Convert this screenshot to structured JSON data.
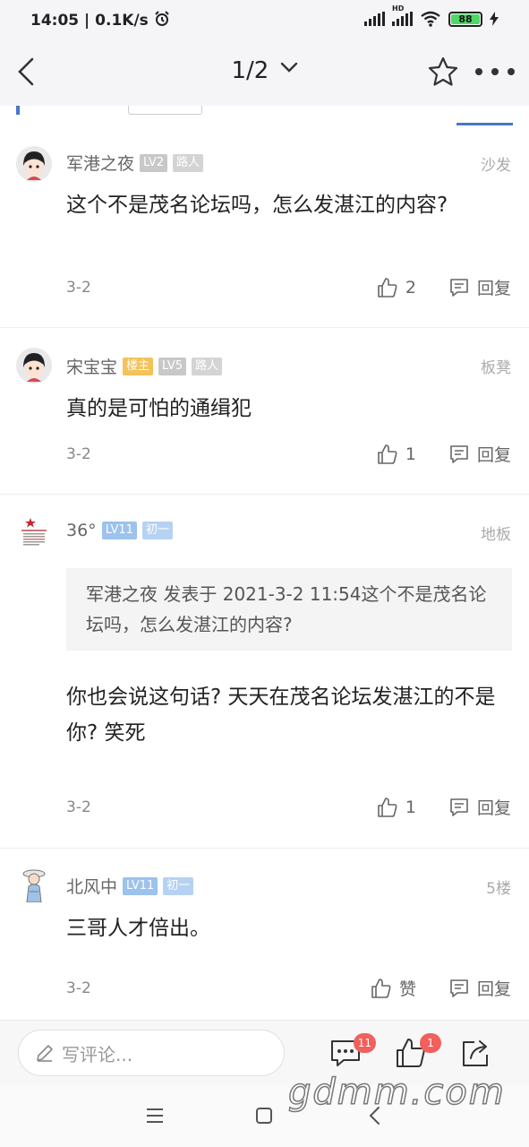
{
  "status_bar": {
    "time": "14:05",
    "speed": "0.1K/s",
    "network_label": "HD",
    "battery": "88"
  },
  "nav": {
    "page": "1/2"
  },
  "posts": [
    {
      "author": "军港之夜",
      "badges": [
        "LV2",
        "路人"
      ],
      "floor": "沙发",
      "content": "这个不是茂名论坛吗，怎么发湛江的内容?",
      "date": "3-2",
      "likes": "2",
      "reply_label": "回复"
    },
    {
      "author": "宋宝宝",
      "badges": [
        "楼主",
        "LV5",
        "路人"
      ],
      "floor": "板凳",
      "content": "真的是可怕的通缉犯",
      "date": "3-2",
      "likes": "1",
      "reply_label": "回复"
    },
    {
      "author": "36°",
      "badges": [
        "LV11",
        "初一"
      ],
      "floor": "地板",
      "quote": "军港之夜 发表于 2021-3-2 11:54这个不是茂名论坛吗，怎么发湛江的内容?",
      "content": "你也会说这句话? 天天在茂名论坛发湛江的不是你? 笑死",
      "date": "3-2",
      "likes": "1",
      "reply_label": "回复"
    },
    {
      "author": "北风中",
      "badges": [
        "LV11",
        "初一"
      ],
      "floor": "5楼",
      "content": "三哥人才倍出。",
      "date": "3-2",
      "likes": "赞",
      "reply_label": "回复"
    }
  ],
  "bottom_bar": {
    "comment_placeholder": "写评论...",
    "comments_count": "11",
    "likes_count": "1"
  },
  "watermark": "gdmm.com",
  "colors": {
    "accent_blue": "#4a76c9",
    "badge_red": "#f25f5c",
    "owner_badge": "#f5c25a"
  }
}
